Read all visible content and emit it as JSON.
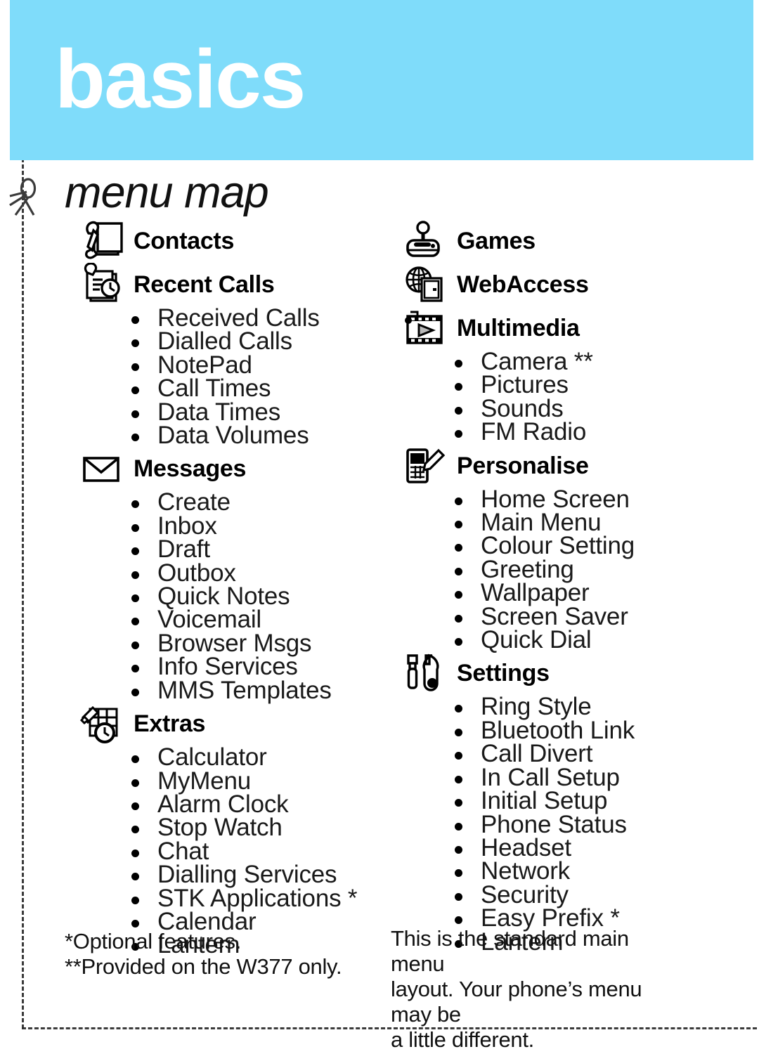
{
  "page": {
    "chapter_title": "basics",
    "section_title": "menu map",
    "banner_color": "#7fdcfa",
    "text_color": "#000000",
    "cut_mark_icon": "scissors-icon"
  },
  "columns": {
    "left": [
      {
        "icon": "contacts-icon",
        "label": "Contacts",
        "items": []
      },
      {
        "icon": "recent-calls-icon",
        "label": "Recent Calls",
        "items": [
          "Received Calls",
          "Dialled Calls",
          "NotePad",
          "Call Times",
          "Data Times",
          "Data Volumes"
        ]
      },
      {
        "icon": "messages-icon",
        "label": "Messages",
        "items": [
          "Create",
          "Inbox",
          "Draft",
          "Outbox",
          "Quick Notes",
          "Voicemail",
          "Browser Msgs",
          "Info Services",
          "MMS Templates"
        ]
      },
      {
        "icon": "extras-icon",
        "label": "Extras",
        "items": [
          "Calculator",
          "MyMenu",
          "Alarm Clock",
          "Stop Watch",
          "Chat",
          "Dialling Services",
          "STK Applications *",
          "Calendar",
          "Lantern"
        ]
      }
    ],
    "right": [
      {
        "icon": "games-icon",
        "label": "Games",
        "items": []
      },
      {
        "icon": "webaccess-icon",
        "label": "WebAccess",
        "items": []
      },
      {
        "icon": "multimedia-icon",
        "label": "Multimedia",
        "items": [
          "Camera **",
          "Pictures",
          "Sounds",
          "FM Radio"
        ]
      },
      {
        "icon": "personalise-icon",
        "label": "Personalise",
        "items": [
          "Home Screen",
          "Main Menu",
          "Colour Setting",
          "Greeting",
          "Wallpaper",
          "Screen Saver",
          "Quick Dial"
        ]
      },
      {
        "icon": "settings-icon",
        "label": "Settings",
        "items": [
          "Ring Style",
          "Bluetooth Link",
          "Call Divert",
          "In Call Setup",
          "Initial Setup",
          "Phone Status",
          "Headset",
          "Network",
          "Security",
          "Easy Prefix *",
          "Lantern"
        ]
      }
    ]
  },
  "footnotes": {
    "left_line_1": "*Optional features.",
    "left_line_2": "**Provided on the W377 only.",
    "right_line_1": "This is the standard main menu",
    "right_line_2": "layout. Your phone’s menu may be",
    "right_line_3": "a little different."
  }
}
